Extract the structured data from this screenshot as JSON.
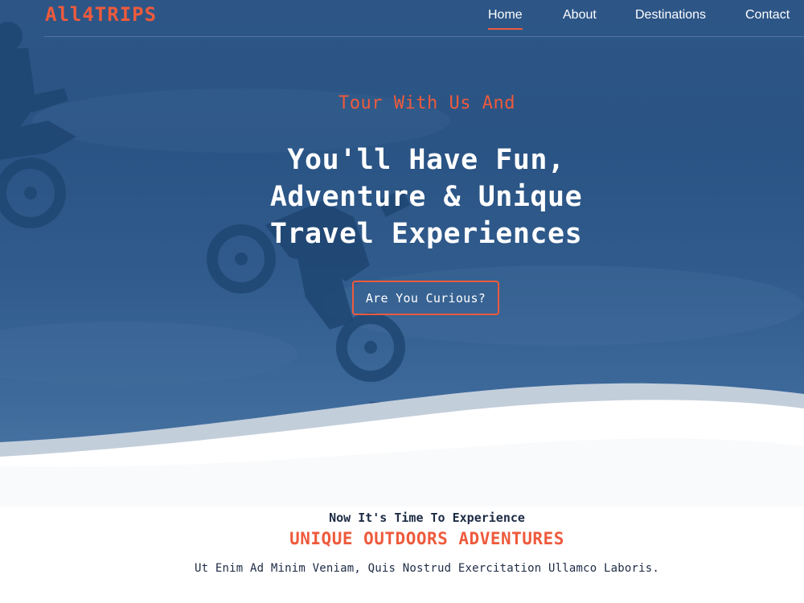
{
  "brand": {
    "logo": "All4TRIPS",
    "accent_color": "#ee5a3c",
    "hero_color": "#2d5687"
  },
  "nav": {
    "items": [
      {
        "label": "Home",
        "active": true
      },
      {
        "label": "About",
        "active": false
      },
      {
        "label": "Destinations",
        "active": false
      },
      {
        "label": "Contact",
        "active": false
      }
    ]
  },
  "hero": {
    "kicker": "Tour With Us And",
    "title_lines": [
      "You'll Have Fun,",
      "Adventure & Unique",
      "Travel Experiences"
    ],
    "cta_label": "Are You Curious?"
  },
  "intro": {
    "kicker": "Now It's Time To Experience",
    "title": "UNIQUE OUTDOORS ADVENTURES",
    "text": "Ut Enim Ad Minim Veniam, Quis Nostrud Exercitation Ullamco Laboris."
  }
}
